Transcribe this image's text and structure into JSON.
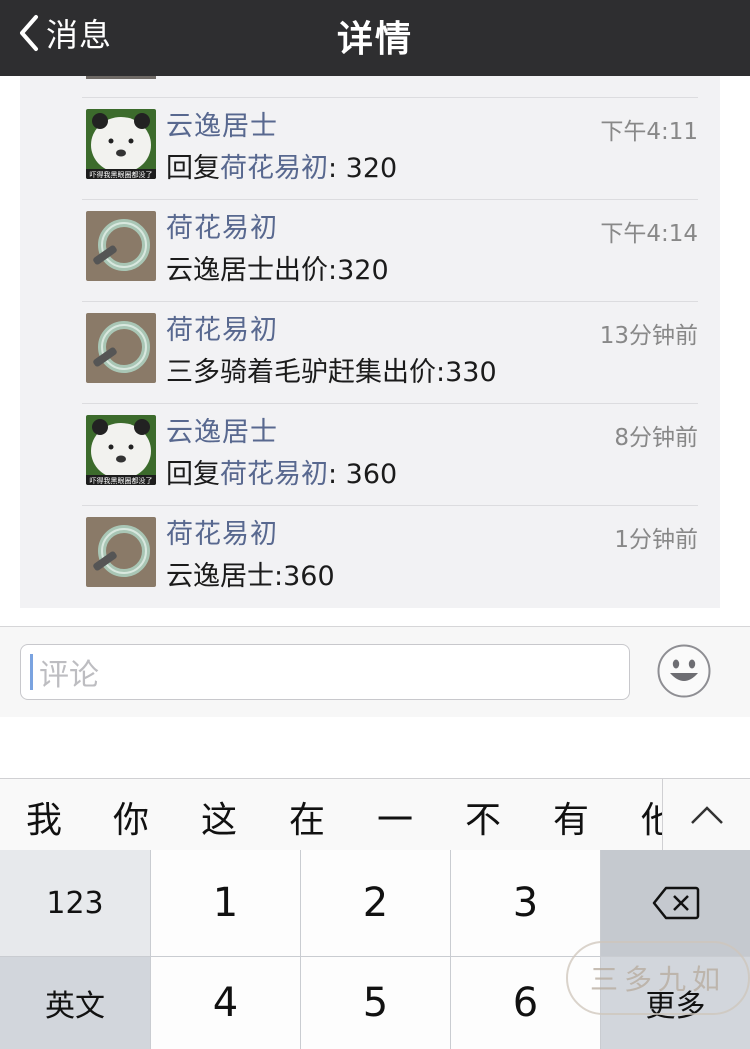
{
  "nav": {
    "back_label": "消息",
    "title": "详情"
  },
  "comments": [
    {
      "name": "云逸居士",
      "time": "下午4:11",
      "prefix": "回复",
      "mention": "荷花易初",
      "suffix": ": 320",
      "avatar": "panda-avatar"
    },
    {
      "name": "荷花易初",
      "time": "下午4:14",
      "prefix": "云逸居士出价:320",
      "mention": "",
      "suffix": "",
      "avatar": "jade-bangle-avatar"
    },
    {
      "name": "荷花易初",
      "time": "13分钟前",
      "prefix": "三多骑着毛驴赶集出价:330",
      "mention": "",
      "suffix": "",
      "avatar": "jade-bangle-avatar"
    },
    {
      "name": "云逸居士",
      "time": "8分钟前",
      "prefix": "回复",
      "mention": "荷花易初",
      "suffix": ": 360",
      "avatar": "panda-avatar"
    },
    {
      "name": "荷花易初",
      "time": "1分钟前",
      "prefix": "云逸居士:360",
      "mention": "",
      "suffix": "",
      "avatar": "jade-bangle-avatar"
    }
  ],
  "panda_caption": "吓得我黑眼圈都没了",
  "input": {
    "placeholder": "评论"
  },
  "candidates": [
    "我",
    "你",
    "这",
    "在",
    "一",
    "不",
    "有",
    "他"
  ],
  "keyboard": {
    "row1": [
      "123",
      "1",
      "2",
      "3"
    ],
    "row2": [
      "英文",
      "4",
      "5",
      "6",
      "更多"
    ]
  },
  "watermark": "三多九如",
  "colors": {
    "nav_bg": "#2e2e30",
    "name_link": "#58688f",
    "list_bg": "#f2f2f4"
  }
}
